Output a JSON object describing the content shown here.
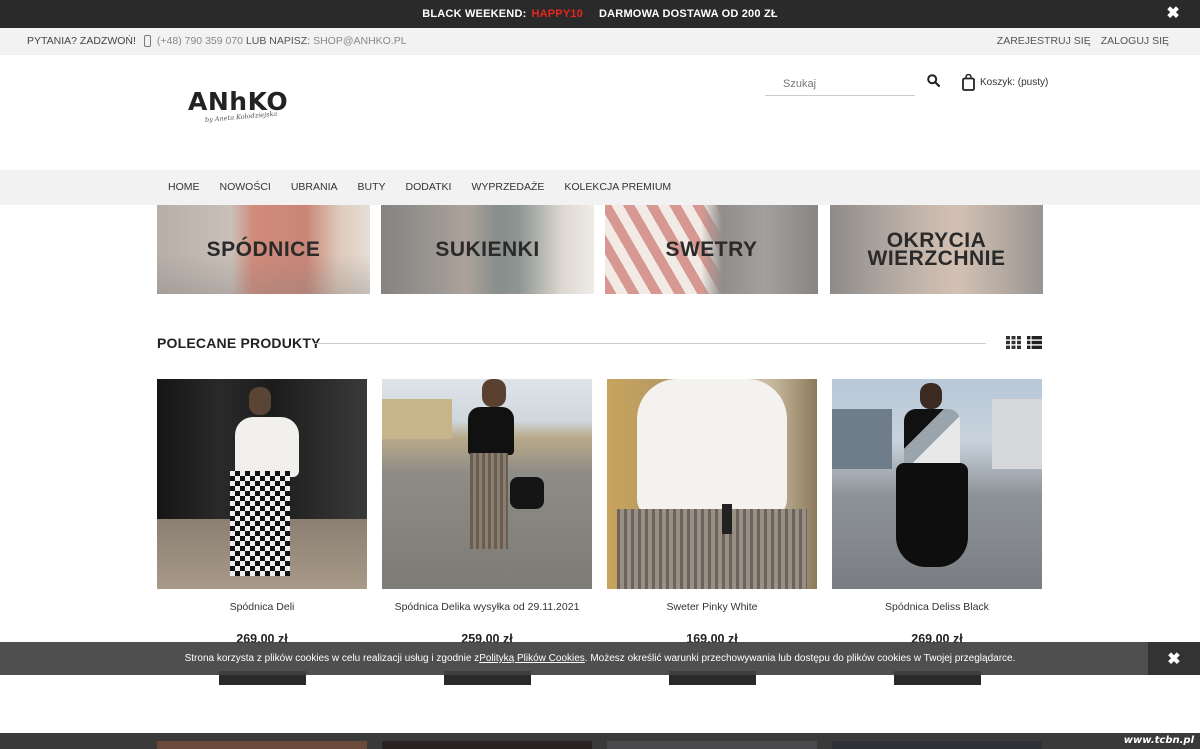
{
  "promo": {
    "label": "BLACK WEEKEND:",
    "code": "HAPPY10",
    "shipping": "DARMOWA DOSTAWA OD 200 ZŁ",
    "close_glyph": "✖"
  },
  "contact": {
    "ask": "PYTANIA? ZADZWOŃ!",
    "phone": "(+48) 790 359 070",
    "or_write": "LUB NAPISZ:",
    "email": "SHOP@ANHKO.PL",
    "register": "ZAREJESTRUJ SIĘ",
    "login": "ZALOGUJ SIĘ",
    "phone_icon": "phone-icon"
  },
  "header": {
    "logo_main": "ANhKO",
    "logo_sub": "by Aneta Kołodziejska",
    "search_placeholder": "Szukaj",
    "cart_label": "Koszyk: (pusty)"
  },
  "nav": {
    "items": [
      "HOME",
      "NOWOŚCI",
      "UBRANIA",
      "BUTY",
      "DODATKI",
      "WYPRZEDAŻE",
      "KOLEKCJA PREMIUM"
    ]
  },
  "categories": [
    {
      "label": "SPÓDNICE"
    },
    {
      "label": "SUKIENKI"
    },
    {
      "label": "SWETRY"
    },
    {
      "label": "OKRYCIA WIERZCHNIE"
    }
  ],
  "featured": {
    "title": "POLECANE PRODUKTY"
  },
  "products": [
    {
      "name": "Spódnica Deli",
      "price": "269,00 zł"
    },
    {
      "name": "Spódnica Delika wysyłka od 29.11.2021",
      "price": "259,00 zł"
    },
    {
      "name": "Sweter Pinky White",
      "price": "169,00 zł"
    },
    {
      "name": "Spódnica Deliss Black",
      "price": "269,00 zł"
    }
  ],
  "cookie": {
    "before": "Strona korzysta z plików cookies w celu realizacji usług i zgodnie z ",
    "link": "Polityką Plików Cookies",
    "after": ". Możesz określić warunki przechowywania lub dostępu do plików cookies w Twojej przeglądarce.",
    "close_glyph": "✖"
  },
  "watermark": "www.tcbn.pl",
  "colors": {
    "promo_bg": "#2a2a2a",
    "promo_code": "#e8261d",
    "topbar_bg": "#f2f2f2",
    "cookie_bg": "#404040"
  }
}
